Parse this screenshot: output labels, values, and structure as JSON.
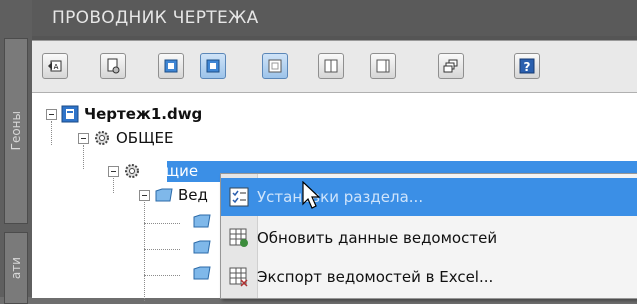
{
  "side": {
    "tab1": "Геоны",
    "tab2": "ати"
  },
  "panel": {
    "title": "ПРОВОДНИК ЧЕРТЕЖА"
  },
  "tree": {
    "root": "Чертеж1.dwg",
    "general": "ОБЩЕЕ",
    "common": "Общие",
    "child_partial": "Вед"
  },
  "menu": {
    "items": [
      {
        "label": "Установки раздела...",
        "icon": "checklist-icon",
        "highlighted": true
      },
      {
        "label": "Обновить данные ведомостей",
        "icon": "table-refresh-icon",
        "highlighted": false
      },
      {
        "label": "Экспорт ведомостей в Excel...",
        "icon": "table-export-icon",
        "highlighted": false
      }
    ]
  },
  "colors": {
    "selection": "#3b8fe6",
    "panel_bg": "#555555",
    "toolbar_bg": "#e9e9e9"
  }
}
